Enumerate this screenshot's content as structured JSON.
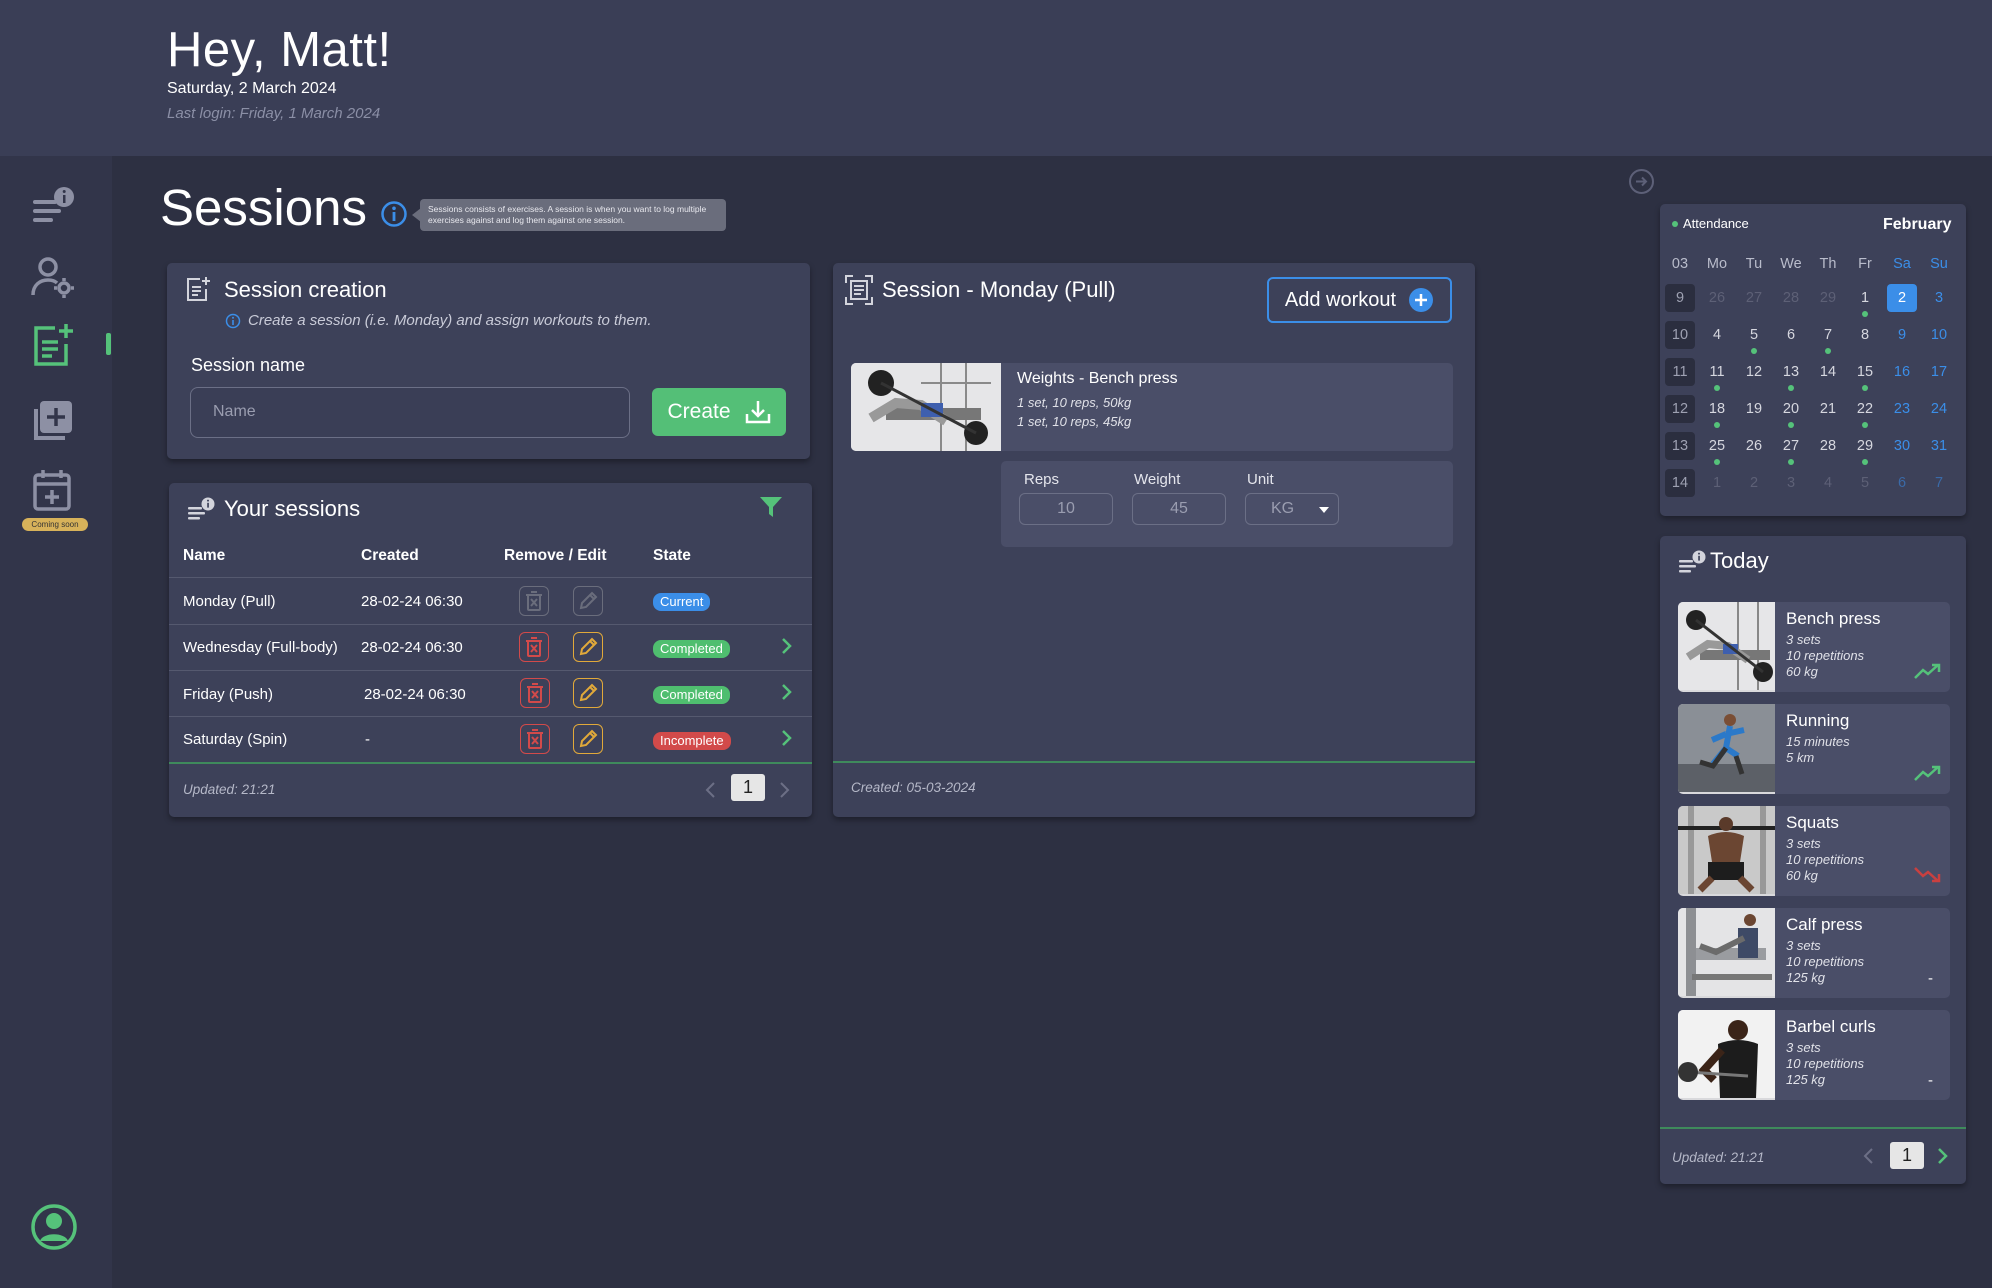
{
  "header": {
    "greeting": "Hey, Matt!",
    "date": "Saturday, 2 March 2024",
    "last_login": "Last login: Friday, 1 March 2024"
  },
  "sidebar": {
    "items": [
      {
        "name": "info-list",
        "icon": "list-info-icon"
      },
      {
        "name": "user-settings",
        "icon": "user-gear-icon"
      },
      {
        "name": "sessions",
        "icon": "note-plus-icon",
        "active": true
      },
      {
        "name": "add-workout",
        "icon": "copy-plus-icon"
      },
      {
        "name": "calendar",
        "icon": "calendar-plus-icon",
        "badge": "Coming soon"
      }
    ],
    "profile_icon": "user-circle-icon"
  },
  "page": {
    "title": "Sessions",
    "tooltip": "Sessions consists of exercises. A session is when you want to log multiple exercises against and log them against one session."
  },
  "session_creation": {
    "title": "Session creation",
    "hint": "Create a session (i.e. Monday) and assign workouts to them.",
    "field_label": "Session name",
    "placeholder": "Name",
    "create_label": "Create"
  },
  "your_sessions": {
    "title": "Your sessions",
    "columns": [
      "Name",
      "Created",
      "Remove / Edit",
      "State"
    ],
    "rows": [
      {
        "name": "Monday (Pull)",
        "created": "28-02-24 06:30",
        "state": "Current",
        "state_color": "#3b8ee8",
        "enabled": false
      },
      {
        "name": "Wednesday (Full-body)",
        "created": "28-02-24 06:30",
        "state": "Completed",
        "state_color": "#4fbe6f",
        "enabled": true
      },
      {
        "name": "Friday (Push)",
        "created": "28-02-24 06:30",
        "state": "Completed",
        "state_color": "#4fbe6f",
        "enabled": true
      },
      {
        "name": "Saturday (Spin)",
        "created": "-",
        "state": "Incomplete",
        "state_color": "#d24a4a",
        "enabled": true
      }
    ],
    "updated": "Updated: 21:21",
    "page": "1"
  },
  "session_detail": {
    "title": "Session - Monday (Pull)",
    "add_workout_label": "Add workout",
    "workout": {
      "name": "Weights - Bench press",
      "lines": [
        "1 set, 10 reps, 50kg",
        "1 set, 10 reps, 45kg"
      ]
    },
    "inputs": {
      "reps_label": "Reps",
      "reps_value": "10",
      "weight_label": "Weight",
      "weight_value": "45",
      "unit_label": "Unit",
      "unit_value": "KG"
    },
    "created": "Created: 05-03-2024"
  },
  "calendar": {
    "legend": "Attendance",
    "month": "February",
    "headers": [
      "03",
      "Mo",
      "Tu",
      "We",
      "Th",
      "Fr",
      "Sa",
      "Su"
    ],
    "weeks": [
      {
        "wk": "9",
        "days": [
          "26",
          "27",
          "28",
          "29",
          "1",
          "2",
          "3"
        ]
      },
      {
        "wk": "10",
        "days": [
          "4",
          "5",
          "6",
          "7",
          "8",
          "9",
          "10"
        ]
      },
      {
        "wk": "11",
        "days": [
          "11",
          "12",
          "13",
          "14",
          "15",
          "16",
          "17"
        ]
      },
      {
        "wk": "12",
        "days": [
          "18",
          "19",
          "20",
          "21",
          "22",
          "23",
          "24"
        ]
      },
      {
        "wk": "13",
        "days": [
          "25",
          "26",
          "27",
          "28",
          "29",
          "30",
          "31"
        ]
      },
      {
        "wk": "14",
        "days": [
          "1",
          "2",
          "3",
          "4",
          "5",
          "6",
          "7"
        ]
      }
    ],
    "selected_day": "2",
    "colors": {
      "weekend": "#3b8ee8",
      "dot": "#55c27a",
      "selected": "#3b8ee8"
    }
  },
  "today": {
    "title": "Today",
    "items": [
      {
        "name": "Bench press",
        "lines": [
          "3 sets",
          "10 repetitions",
          "60 kg"
        ],
        "trend": "up"
      },
      {
        "name": "Running",
        "lines": [
          "15 minutes",
          "5 km"
        ],
        "trend": "up"
      },
      {
        "name": "Squats",
        "lines": [
          "3 sets",
          "10 repetitions",
          "60 kg"
        ],
        "trend": "down"
      },
      {
        "name": "Calf press",
        "lines": [
          "3 sets",
          "10 repetitions",
          "125 kg"
        ],
        "trend": "-"
      },
      {
        "name": "Barbel curls",
        "lines": [
          "3 sets",
          "10 repetitions",
          "125 kg"
        ],
        "trend": "-"
      }
    ],
    "updated": "Updated: 21:21",
    "page": "1"
  }
}
